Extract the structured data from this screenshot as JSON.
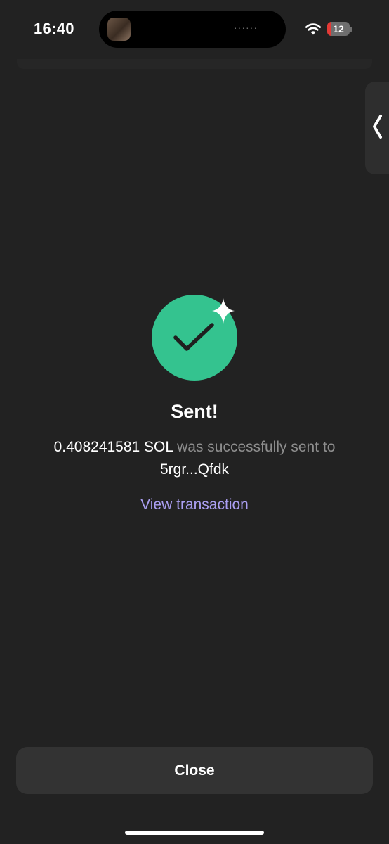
{
  "status_bar": {
    "time": "16:40",
    "island_dots": "······",
    "battery_level": "12",
    "battery_low_color": "#e53935"
  },
  "side_tab": {
    "icon": "chevron-left-icon"
  },
  "success": {
    "icon": "checkmark-circle-icon",
    "sparkle_icon": "sparkle-icon",
    "accent_color": "#34c38f",
    "title": "Sent!",
    "amount": "0.408241581 SOL",
    "message_mid": " was successfully sent to ",
    "recipient": "5rgr...Qfdk",
    "view_link": "View transaction",
    "link_color": "#ab9ff2"
  },
  "footer": {
    "close_label": "Close"
  }
}
